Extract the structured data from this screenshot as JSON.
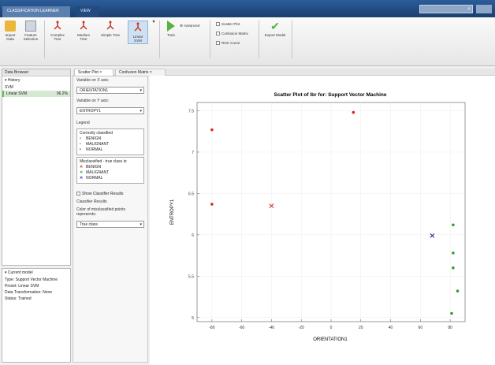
{
  "titlebar": {
    "tabs": [
      "CLASSIFICATION LEARNER",
      "VIEW"
    ]
  },
  "ribbon": {
    "buttons": {
      "import": "Import Data",
      "feature": "Feature Selection",
      "complex_tree": "Complex Tree",
      "medium_tree": "Medium Tree",
      "simple_tree": "Simple Tree",
      "linear_svm": "Linear SVM",
      "advanced": "Advanced",
      "train": "Train",
      "export": "Export Model"
    },
    "plots": [
      "Scatter Plot",
      "Confusion Matrix",
      "ROC Curve"
    ]
  },
  "data_browser": {
    "title": "Data Browser",
    "history_label": "History",
    "history": [
      {
        "name": "SVM",
        "score": ""
      },
      {
        "name": "Linear SVM",
        "score": "96.2%"
      }
    ]
  },
  "current_model": {
    "title": "Current model",
    "lines": [
      "Type: Support Vector Machine",
      "Preset: Linear SVM",
      "Data Transformation: None",
      "Status: Trained"
    ]
  },
  "doc_tabs": [
    "Scatter Plot",
    "Confusion Matrix"
  ],
  "controls": {
    "x_label": "Variable on X axis:",
    "x_value": "ORIENTATION1",
    "y_label": "Variable on Y axis:",
    "y_value": "ENTROPY1",
    "legend_label": "Legend",
    "correct_title": "Correctly classified",
    "mis_title": "Misclassified - true class is:",
    "classes": [
      "BENIGN",
      "MALIGNANT",
      "NORMAL"
    ],
    "show_results": "Show Classifier Results",
    "classifier_results_label": "Classifier Results",
    "color_label": "Color of misclassified points represents:",
    "color_value": "True class"
  },
  "colors": {
    "benign": "#d62728",
    "malignant": "#2ca02c",
    "normal": "#1f1fb4"
  },
  "chart_data": {
    "type": "scatter",
    "title": "Scatter Plot of lbr for: Support Vector Machine",
    "xlabel": "ORIENTATION1",
    "ylabel": "ENTROPY1",
    "xlim": [
      -90,
      90
    ],
    "ylim": [
      4.95,
      7.6
    ],
    "xticks": [
      -80,
      -60,
      -40,
      -20,
      0,
      20,
      40,
      60,
      80
    ],
    "yticks": [
      5,
      5.5,
      6,
      6.5,
      7,
      7.5
    ],
    "series": [
      {
        "name": "BENIGN",
        "marker": "dot",
        "color": "#d62728",
        "x": [
          -80,
          -80,
          15
        ],
        "y": [
          7.27,
          6.37,
          7.48
        ]
      },
      {
        "name": "MALIGNANT",
        "marker": "dot",
        "color": "#2ca02c",
        "x": [
          82,
          82,
          85,
          81,
          82
        ],
        "y": [
          6.12,
          5.78,
          5.32,
          5.05,
          5.6
        ]
      },
      {
        "name": "BENIGN",
        "marker": "x",
        "color": "#d62728",
        "x": [
          -40
        ],
        "y": [
          6.35
        ]
      },
      {
        "name": "NORMAL",
        "marker": "x",
        "color": "#1f1fb4",
        "x": [
          68
        ],
        "y": [
          5.99
        ]
      }
    ]
  }
}
